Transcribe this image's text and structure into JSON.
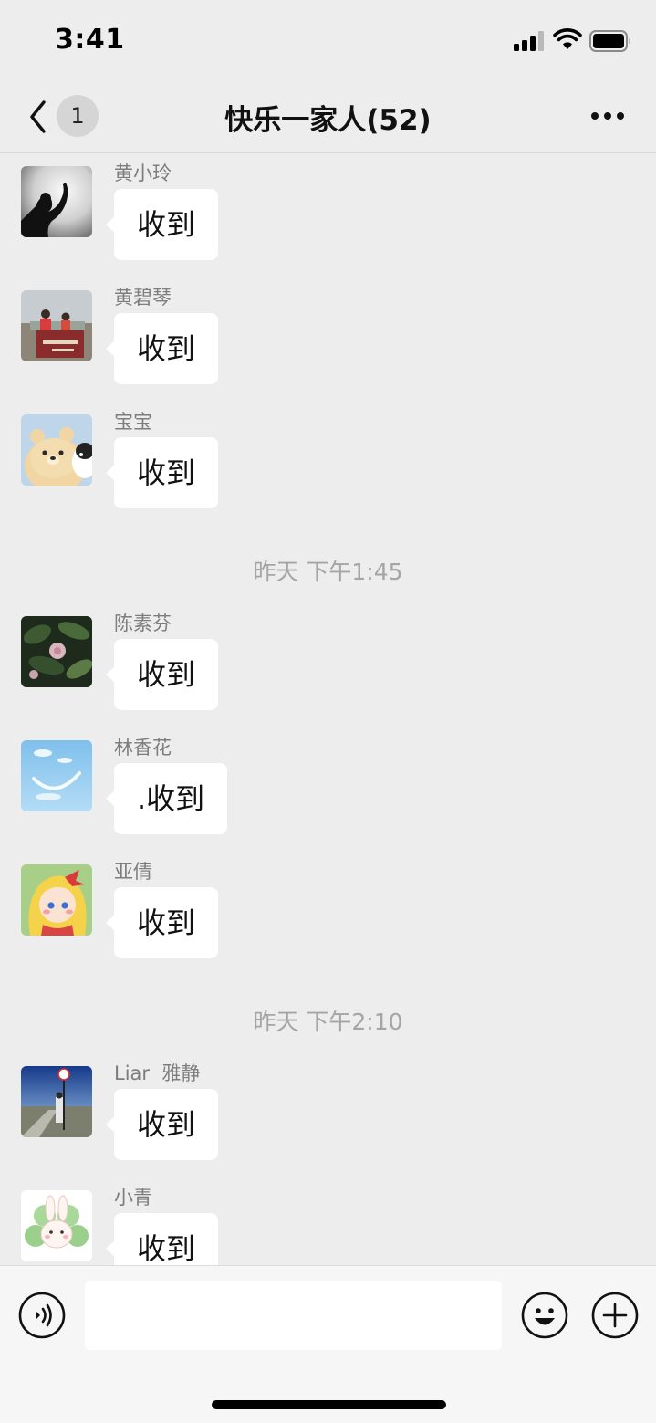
{
  "status_bar": {
    "time": "3:41",
    "signal_bars": 3,
    "signal_max": 4
  },
  "nav": {
    "back_badge": "1",
    "title": "快乐一家人(52)"
  },
  "messages_a": [
    {
      "sender": "黄小玲",
      "text": "收到",
      "avatar": "silhouette-avatar"
    },
    {
      "sender": "黄碧琴",
      "text": "收到",
      "avatar": "children-photo-avatar"
    },
    {
      "sender": "宝宝",
      "text": "收到",
      "avatar": "cartoon-bear-avatar"
    }
  ],
  "time_sep_1": "昨天 下午1:45",
  "messages_b": [
    {
      "sender": "陈素芬",
      "text": "收到",
      "avatar": "flower-photo-avatar"
    },
    {
      "sender": "林香花",
      "text": ".收到",
      "avatar": "sky-smile-avatar"
    },
    {
      "sender": "亚倩",
      "text": "收到",
      "avatar": "anime-girl-avatar"
    }
  ],
  "time_sep_2": "昨天 下午2:10",
  "messages_c": [
    {
      "sender": "Liar  雅静",
      "text": "收到",
      "avatar": "road-photo-avatar"
    },
    {
      "sender": "小青",
      "text": "收到",
      "avatar": "bunny-clover-avatar"
    }
  ],
  "input": {
    "value": "",
    "placeholder": ""
  },
  "icons": {
    "back": "chevron-left-icon",
    "more": "more-dots-icon",
    "voice": "voice-icon",
    "emoji": "emoji-icon",
    "plus": "plus-icon"
  },
  "colors": {
    "background": "#ededed",
    "bubble": "#ffffff",
    "sender_name": "#7d7d7d",
    "time_separator": "#a5a5a5",
    "badge": "#d5d5d5"
  }
}
